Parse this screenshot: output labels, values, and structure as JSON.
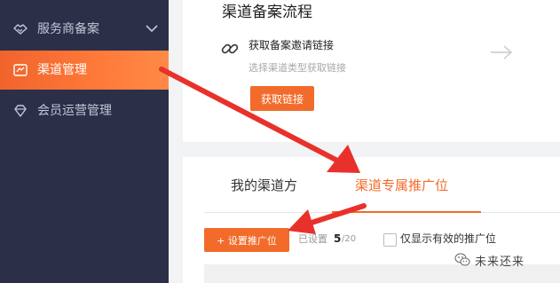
{
  "sidebar": {
    "items": [
      {
        "label": "服务商备案",
        "icon": "handshake-icon",
        "active": false
      },
      {
        "label": "渠道管理",
        "icon": "channel-icon",
        "active": true
      },
      {
        "label": "会员运营管理",
        "icon": "diamond-icon",
        "active": false
      }
    ]
  },
  "flow_card": {
    "title": "渠道备案流程",
    "step_title": "获取备案邀请链接",
    "step_subtitle": "选择渠道类型获取链接",
    "get_link_button": "获取链接"
  },
  "tabs": [
    {
      "label": "我的渠道方",
      "active": false
    },
    {
      "label": "渠道专属推广位",
      "active": true
    }
  ],
  "toolbar": {
    "set_button": "+ 设置推广位",
    "count_label": "已设置",
    "count_value": "5",
    "count_total": "/20",
    "checkbox_label": "仅显示有效的推广位",
    "checkbox_checked": false
  },
  "watermark": {
    "text": "未来还来",
    "icon": "wechat-icon"
  },
  "colors": {
    "accent": "#f26b2b",
    "sidebar_bg": "#2c2f48",
    "annotation_arrow": "#e8312a"
  }
}
